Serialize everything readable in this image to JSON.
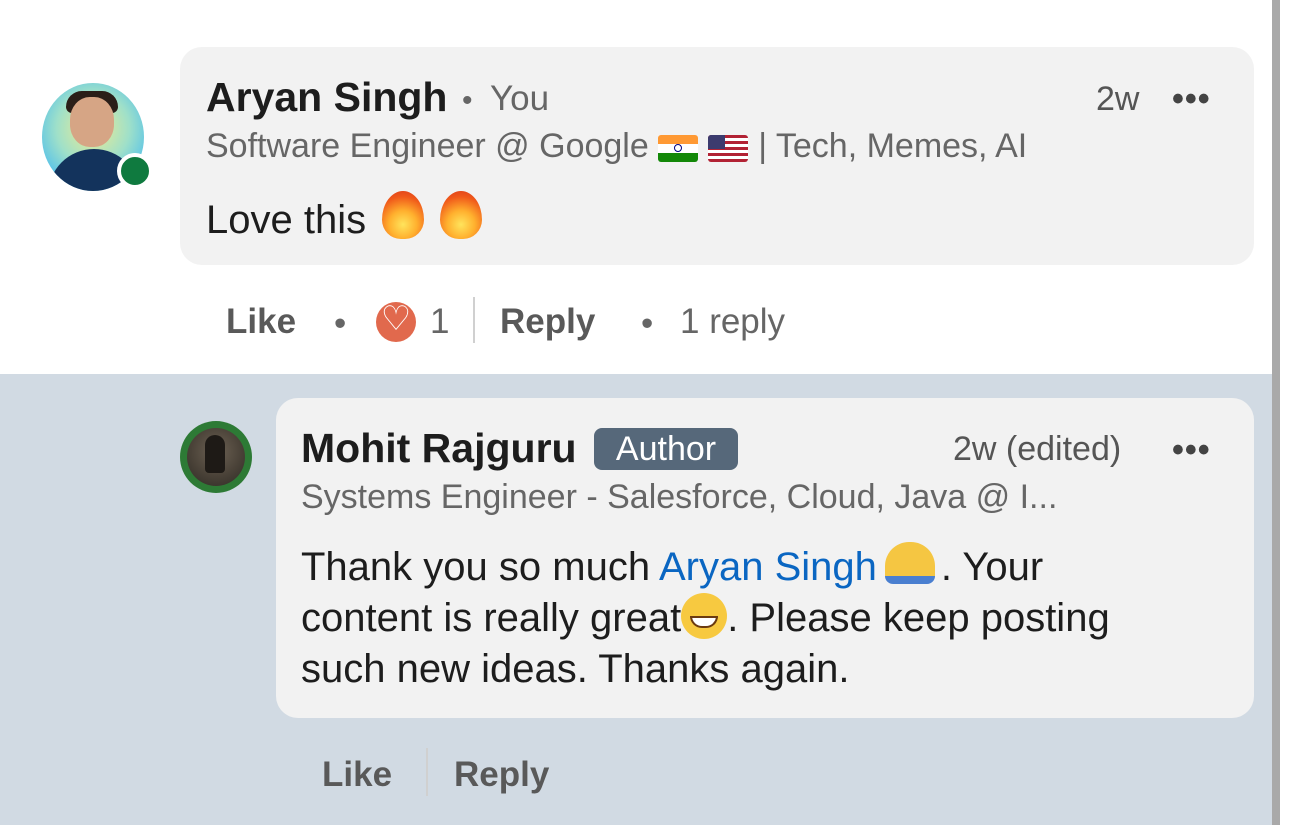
{
  "comment": {
    "author_name": "Aryan Singh",
    "separator": "•",
    "you_label": "You",
    "time": "2w",
    "more_label": "•••",
    "headline_before": "Software Engineer @ Google",
    "headline_flags": [
      "india-flag-icon",
      "usa-flag-icon"
    ],
    "headline_after": "| Tech, Memes, AI",
    "body": "Love this",
    "body_emoji": [
      "fire-emoji",
      "fire-emoji"
    ],
    "actions": {
      "like_label": "Like",
      "dot": "•",
      "reaction_count": "1",
      "reply_label": "Reply",
      "dot2": "•",
      "replies_count_label": "1 reply"
    }
  },
  "reply": {
    "author_name": "Mohit Rajguru",
    "badge": "Author",
    "time": "2w (edited)",
    "more_label": "•••",
    "headline": "Systems Engineer - Salesforce, Cloud, Java @ I...",
    "body_part1": "Thank you so much ",
    "mention": "Aryan Singh",
    "body_part2": ". Your",
    "body_part3": "content is really great",
    "body_part4": ". Please keep posting",
    "body_part5": "such new ideas. Thanks again.",
    "actions": {
      "like_label": "Like",
      "reply_label": "Reply"
    }
  },
  "colors": {
    "reply_section_bg": "#d1dae3",
    "bubble_bg": "#f2f2f2",
    "mention": "#0a66c2",
    "author_badge_bg": "#56687a",
    "presence": "#0f7a3f",
    "reaction_heart": "#e1694d"
  }
}
